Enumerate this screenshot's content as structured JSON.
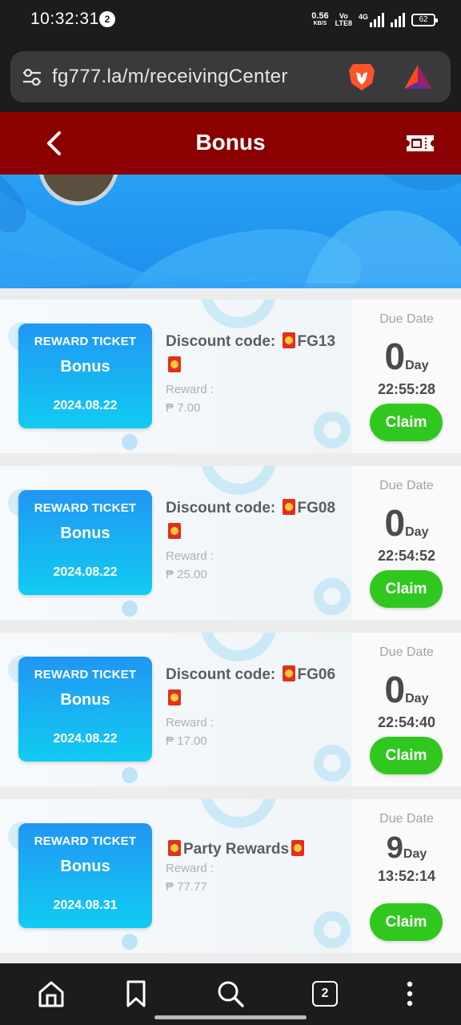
{
  "status_bar": {
    "time": "10:32:31",
    "notification_count": "2",
    "net_speed": "0.56",
    "net_speed_unit": "KB/S",
    "volte_top": "Vo",
    "volte_bottom": "LTE8",
    "network": "4G",
    "battery": "62"
  },
  "browser": {
    "url": "fg777.la/m/receivingCenter",
    "tab_count": "2"
  },
  "header": {
    "title": "Bonus"
  },
  "colors": {
    "header_bg": "#8b0000",
    "banner_bg": "#1d8ef0",
    "ticket_top": "#2196f3",
    "ticket_bottom": "#11ccf2",
    "claim_button": "#30c81e"
  },
  "rewards": [
    {
      "ticket_type": "REWARD TICKET",
      "ticket_name": "Bonus",
      "ticket_date": "2024.08.22",
      "title_prefix": "Discount code:",
      "title_code": "FG13",
      "title_suffix": "",
      "reward_label": "Reward :",
      "reward_amount": "₱ 7.00",
      "due_label": "Due Date",
      "due_days": "0",
      "due_unit": "Day",
      "due_time": "22:55:28",
      "claim_label": "Claim"
    },
    {
      "ticket_type": "REWARD TICKET",
      "ticket_name": "Bonus",
      "ticket_date": "2024.08.22",
      "title_prefix": "Discount code:",
      "title_code": "FG08",
      "title_suffix": "",
      "reward_label": "Reward :",
      "reward_amount": "₱ 25.00",
      "due_label": "Due Date",
      "due_days": "0",
      "due_unit": "Day",
      "due_time": "22:54:52",
      "claim_label": "Claim"
    },
    {
      "ticket_type": "REWARD TICKET",
      "ticket_name": "Bonus",
      "ticket_date": "2024.08.22",
      "title_prefix": "Discount code:",
      "title_code": "FG06",
      "title_suffix": "",
      "reward_label": "Reward :",
      "reward_amount": "₱ 17.00",
      "due_label": "Due Date",
      "due_days": "0",
      "due_unit": "Day",
      "due_time": "22:54:40",
      "claim_label": "Claim"
    },
    {
      "ticket_type": "REWARD TICKET",
      "ticket_name": "Bonus",
      "ticket_date": "2024.08.31",
      "title_prefix": "",
      "title_code": "",
      "title_suffix": "Party Rewards",
      "reward_label": "Reward :",
      "reward_amount": "₱ 77.77",
      "due_label": "Due Date",
      "due_days": "9",
      "due_unit": "Day",
      "due_time": "13:52:14",
      "claim_label": "Claim"
    }
  ],
  "icons": {
    "site_settings": "tune-icon",
    "brave_shield": "brave-lion-icon",
    "brave_rewards": "bat-triangle-icon",
    "back": "chevron-left-icon",
    "ticket": "ticket-icon",
    "nav": [
      "home-icon",
      "bookmark-icon",
      "search-icon",
      "tabs-icon",
      "more-vertical-icon"
    ]
  }
}
